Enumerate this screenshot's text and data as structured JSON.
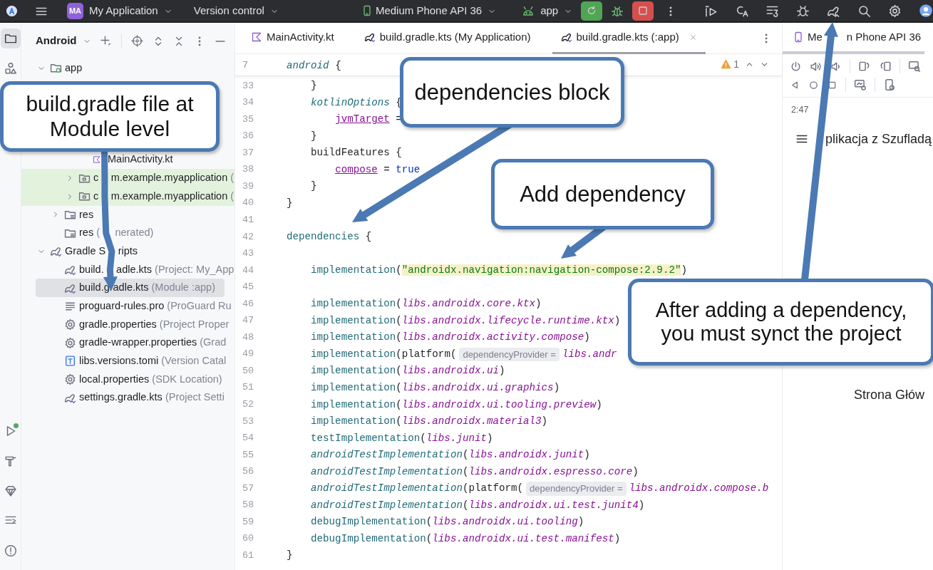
{
  "title_bar": {
    "project_badge": "MA",
    "project": "My Application",
    "vcs": "Version control",
    "device": "Medium Phone API 36",
    "run_config": "app"
  },
  "tool_strip": [
    {
      "kind": "project",
      "selected": true
    },
    {
      "kind": "structure",
      "selected": false
    }
  ],
  "project_panel": {
    "view": "Android",
    "tree": [
      {
        "label": "app",
        "kind": "module",
        "expanded": true,
        "selected": false,
        "highlighted": false,
        "children": [
          {
            "children": [
              {
                "children": [
                  {
                    "label": "MainActivity.kt",
                    "kind": "kotlin",
                    "selected": false,
                    "highlighted": false
                  }
                ]
              },
              {
                "label": [
                  "c",
                  "m.example.myapplication"
                ],
                "note": "(",
                "kind": "package",
                "expanded": false,
                "selected": false,
                "highlighted": true
              },
              {
                "label": [
                  "c",
                  "m.example.myapplication"
                ],
                "note": "(",
                "kind": "package",
                "expanded": false,
                "selected": false,
                "highlighted": true
              }
            ]
          },
          {
            "label": "res",
            "kind": "res",
            "expanded": false,
            "selected": false,
            "highlighted": false
          },
          {
            "label": "res",
            "note": [
              "(",
              "nerated)"
            ],
            "kind": "res",
            "selected": false,
            "highlighted": false
          }
        ]
      },
      {
        "label": [
          "Gradle S",
          "ripts"
        ],
        "kind": "gradle",
        "expanded": true,
        "selected": false,
        "highlighted": false,
        "children": [
          {
            "label": [
              "build.",
              "adle.kts"
            ],
            "note": "(Project: My_App",
            "kind": "gradle",
            "selected": false,
            "highlighted": false
          },
          {
            "label": "build.gradle.kts",
            "note": "(Module :app)",
            "kind": "gradle",
            "selected": true,
            "highlighted": false
          },
          {
            "label": "proguard-rules.pro",
            "note": "(ProGuard Ru",
            "kind": "text",
            "selected": false,
            "highlighted": false
          },
          {
            "label": "gradle.properties",
            "note": "(Project Proper",
            "kind": "settings",
            "selected": false,
            "highlighted": false
          },
          {
            "label": "gradle-wrapper.properties",
            "note": "(Grad",
            "kind": "settings",
            "selected": false,
            "highlighted": false
          },
          {
            "label": "libs.versions.tomi",
            "note": "(Version Catal",
            "kind": "toml",
            "selected": false,
            "highlighted": false
          },
          {
            "label": "local.properties",
            "note": "(SDK Location)",
            "kind": "settings",
            "selected": false,
            "highlighted": false
          },
          {
            "label": "settings.gradle.kts",
            "note": "(Project Setti",
            "kind": "gradle",
            "selected": false,
            "highlighted": false
          }
        ]
      }
    ]
  },
  "editor": {
    "tabs": [
      {
        "label": "MainActivity.kt",
        "kind": "kotlin",
        "selected": false
      },
      {
        "label": "build.gradle.kts (My Application)",
        "kind": "gradle",
        "selected": false
      },
      {
        "label": "build.gradle.kts (:app)",
        "kind": "gradle",
        "selected": true
      }
    ],
    "warning_count": "1",
    "sticky_line": {
      "number": "7",
      "tokens": [
        {
          "text": "android",
          "kind": "italic-call"
        },
        {
          "text": " {",
          "kind": "text"
        }
      ]
    },
    "lines": [
      {
        "number": "33",
        "tokens": [
          {
            "text": "    }",
            "kind": "text"
          }
        ]
      },
      {
        "number": "34",
        "tokens": [
          {
            "text": "    kotlinOptions",
            "kind": "italic-call"
          },
          {
            "text": " {",
            "kind": "text"
          }
        ]
      },
      {
        "number": "35",
        "tokens": [
          {
            "text": "        jvmTarget",
            "kind": "prop"
          },
          {
            "text": " =",
            "kind": "text"
          }
        ]
      },
      {
        "number": "36",
        "tokens": [
          {
            "text": "    }",
            "kind": "text"
          }
        ]
      },
      {
        "number": "37",
        "tokens": [
          {
            "text": "    buildFeatures {",
            "kind": "text"
          }
        ]
      },
      {
        "number": "38",
        "tokens": [
          {
            "text": "        compose",
            "kind": "prop"
          },
          {
            "text": " = ",
            "kind": "text"
          },
          {
            "text": "true",
            "kind": "keyword"
          }
        ]
      },
      {
        "number": "39",
        "tokens": [
          {
            "text": "    }",
            "kind": "text"
          }
        ]
      },
      {
        "number": "40",
        "tokens": [
          {
            "text": "}",
            "kind": "text"
          }
        ]
      },
      {
        "number": "41"
      },
      {
        "number": "42",
        "tokens": [
          {
            "text": "dependencies",
            "kind": "call"
          },
          {
            "text": " {",
            "kind": "text"
          }
        ]
      },
      {
        "number": "43"
      },
      {
        "number": "44",
        "tokens": [
          {
            "text": "    implementation",
            "kind": "call"
          },
          {
            "text": "(",
            "kind": "text"
          },
          {
            "text": "\"androidx.navigation:navigation-compose:2.9.2\"",
            "kind": "string"
          },
          {
            "text": ")",
            "kind": "text"
          }
        ]
      },
      {
        "number": "45"
      },
      {
        "number": "46",
        "tokens": [
          {
            "text": "    implementation",
            "kind": "call"
          },
          {
            "text": "(",
            "kind": "text"
          },
          {
            "text": "libs.androidx.core.ktx",
            "kind": "ref"
          },
          {
            "text": ")",
            "kind": "text"
          }
        ]
      },
      {
        "number": "47",
        "tokens": [
          {
            "text": "    implementation",
            "kind": "call"
          },
          {
            "text": "(",
            "kind": "text"
          },
          {
            "text": "libs.androidx.lifecycle.runtime.ktx",
            "kind": "ref"
          },
          {
            "text": ")",
            "kind": "text"
          }
        ]
      },
      {
        "number": "48",
        "tokens": [
          {
            "text": "    implementation",
            "kind": "call"
          },
          {
            "text": "(",
            "kind": "text"
          },
          {
            "text": "libs.androidx.activity.compose",
            "kind": "ref"
          },
          {
            "text": ")",
            "kind": "text"
          }
        ]
      },
      {
        "number": "49",
        "tokens": [
          {
            "text": "    implementation",
            "kind": "call"
          },
          {
            "text": "(platform(",
            "kind": "text"
          },
          {
            "text": "dependencyProvider =",
            "kind": "hint"
          },
          {
            "text": "libs.andr",
            "kind": "ref"
          }
        ]
      },
      {
        "number": "50",
        "tokens": [
          {
            "text": "    implementation",
            "kind": "call"
          },
          {
            "text": "(",
            "kind": "text"
          },
          {
            "text": "libs.androidx.ui",
            "kind": "ref"
          },
          {
            "text": ")",
            "kind": "text"
          }
        ]
      },
      {
        "number": "51",
        "tokens": [
          {
            "text": "    implementation",
            "kind": "call"
          },
          {
            "text": "(",
            "kind": "text"
          },
          {
            "text": "libs.androidx.ui.graphics",
            "kind": "ref"
          },
          {
            "text": ")",
            "kind": "text"
          }
        ]
      },
      {
        "number": "52",
        "tokens": [
          {
            "text": "    implementation",
            "kind": "call"
          },
          {
            "text": "(",
            "kind": "text"
          },
          {
            "text": "libs.androidx.ui.tooling.preview",
            "kind": "ref"
          },
          {
            "text": ")",
            "kind": "text"
          }
        ]
      },
      {
        "number": "53",
        "tokens": [
          {
            "text": "    implementation",
            "kind": "call"
          },
          {
            "text": "(",
            "kind": "text"
          },
          {
            "text": "libs.androidx.material3",
            "kind": "ref"
          },
          {
            "text": ")",
            "kind": "text"
          }
        ]
      },
      {
        "number": "54",
        "tokens": [
          {
            "text": "    testImplementation",
            "kind": "call"
          },
          {
            "text": "(",
            "kind": "text"
          },
          {
            "text": "libs.junit",
            "kind": "ref"
          },
          {
            "text": ")",
            "kind": "text"
          }
        ]
      },
      {
        "number": "55",
        "tokens": [
          {
            "text": "    androidTestImplementation",
            "kind": "italic-call"
          },
          {
            "text": "(",
            "kind": "text"
          },
          {
            "text": "libs.androidx.junit",
            "kind": "ref"
          },
          {
            "text": ")",
            "kind": "text"
          }
        ]
      },
      {
        "number": "56",
        "tokens": [
          {
            "text": "    androidTestImplementation",
            "kind": "italic-call"
          },
          {
            "text": "(",
            "kind": "text"
          },
          {
            "text": "libs.androidx.espresso.core",
            "kind": "ref"
          },
          {
            "text": ")",
            "kind": "text"
          }
        ]
      },
      {
        "number": "57",
        "tokens": [
          {
            "text": "    androidTestImplementation",
            "kind": "italic-call"
          },
          {
            "text": "(platform(",
            "kind": "text"
          },
          {
            "text": "dependencyProvider =",
            "kind": "hint"
          },
          {
            "text": "libs.androidx.compose.b",
            "kind": "ref"
          }
        ]
      },
      {
        "number": "58",
        "tokens": [
          {
            "text": "    androidTestImplementation",
            "kind": "italic-call"
          },
          {
            "text": "(",
            "kind": "text"
          },
          {
            "text": "libs.androidx.ui.test.junit4",
            "kind": "ref"
          },
          {
            "text": ")",
            "kind": "text"
          }
        ]
      },
      {
        "number": "59",
        "tokens": [
          {
            "text": "    debugImplementation",
            "kind": "call"
          },
          {
            "text": "(",
            "kind": "text"
          },
          {
            "text": "libs.androidx.ui.tooling",
            "kind": "ref"
          },
          {
            "text": ")",
            "kind": "text"
          }
        ]
      },
      {
        "number": "60",
        "tokens": [
          {
            "text": "    debugImplementation",
            "kind": "call"
          },
          {
            "text": "(",
            "kind": "text"
          },
          {
            "text": "libs.androidx.ui.test.manifest",
            "kind": "ref"
          },
          {
            "text": ")",
            "kind": "text"
          }
        ]
      },
      {
        "number": "61",
        "tokens": [
          {
            "text": "}",
            "kind": "text"
          }
        ]
      }
    ]
  },
  "device_panel": {
    "tab": [
      "Me",
      "n Phone API 36"
    ],
    "time": "2:47",
    "app_title": "plikacja z Szufladą",
    "content": "Strona Głów"
  },
  "annotations": [
    {
      "text": "build.gradle file at Module level"
    },
    {
      "text": "dependencies block"
    },
    {
      "text": "Add dependency"
    },
    {
      "text": "After adding a dependency, you must synct the project"
    }
  ]
}
